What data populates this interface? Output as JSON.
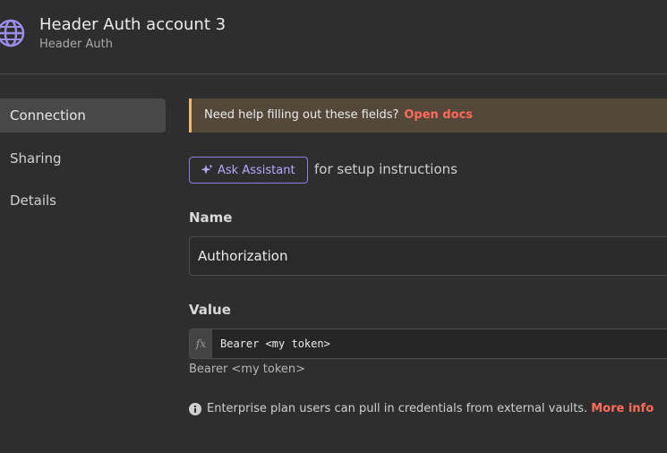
{
  "header": {
    "title": "Header Auth account 3",
    "subtitle": "Header Auth",
    "icon": "globe-icon"
  },
  "sidebar": {
    "items": [
      {
        "label": "Connection",
        "active": true
      },
      {
        "label": "Sharing",
        "active": false
      },
      {
        "label": "Details",
        "active": false
      }
    ]
  },
  "notice": {
    "text": "Need help filling out these fields?",
    "link": "Open docs"
  },
  "assistant": {
    "button_label": "Ask Assistant",
    "suffix": "for setup instructions"
  },
  "name_field": {
    "label": "Name",
    "value": "Authorization"
  },
  "value_field": {
    "label": "Value",
    "fx": "fx",
    "expression": "Bearer <my token>",
    "preview": "Bearer <my token>"
  },
  "enterprise": {
    "text": "Enterprise plan users can pull in credentials from external vaults.",
    "link": "More info"
  },
  "colors": {
    "background": "#2e2e2e",
    "accent_link": "#ff6b5a",
    "assistant_accent": "#8f7ee8",
    "notice_border": "#f0b56b"
  }
}
